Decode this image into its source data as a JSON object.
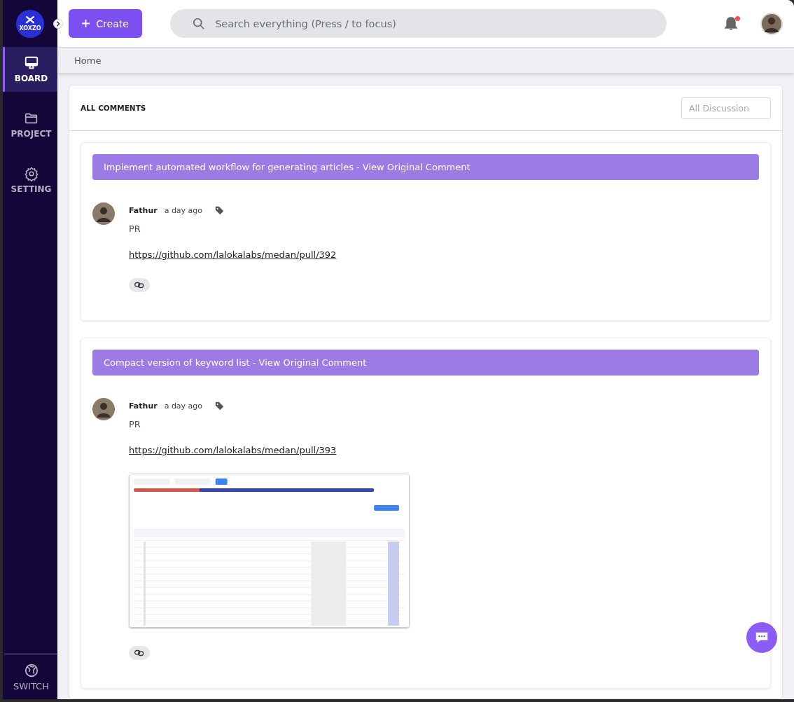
{
  "sidebar": {
    "logo": "XOXZO",
    "items": [
      {
        "label": "BOARD",
        "kind": "monitor",
        "selected": true
      },
      {
        "label": "PROJECT",
        "kind": "folder",
        "selected": false
      },
      {
        "label": "SETTING",
        "kind": "gear",
        "selected": false
      }
    ],
    "footer": {
      "label": "SWITCH"
    }
  },
  "topbar": {
    "create_button": "Create",
    "search": {
      "placeholder": "Search everything (Press / to focus)"
    },
    "notifications": {
      "unread": true
    }
  },
  "breadcrumb": "Home",
  "panel": {
    "title": "ALL COMMENTS",
    "filter": {
      "placeholder": "All Discussion"
    },
    "comments": [
      {
        "heading": "Implement automated workflow for generating articles - View Original Comment",
        "author": "Fathur",
        "time": "a day ago",
        "body": "PR",
        "link": "https://github.com/lalokalabs/medan/pull/392"
      },
      {
        "heading": "Compact version of keyword list - View Original Comment",
        "author": "Fathur",
        "time": "a day ago",
        "body": "PR",
        "link": "https://github.com/lalokalabs/medan/pull/393"
      }
    ]
  }
}
